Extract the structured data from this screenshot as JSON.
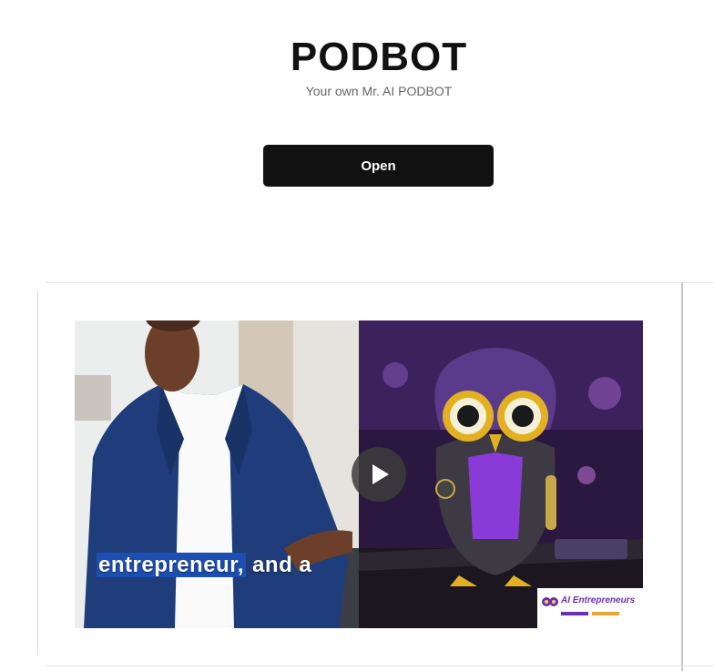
{
  "header": {
    "title": "PODBOT",
    "subtitle": "Your own Mr. AI PODBOT"
  },
  "actions": {
    "open_label": "Open"
  },
  "video": {
    "caption_highlight": "entrepreneur,",
    "caption_rest": " and a",
    "watermark_text": "AI Entrepreneurs",
    "play_icon": "play-icon"
  },
  "colors": {
    "button_bg": "#111111",
    "caption_highlight": "#1d4fb3",
    "watermark_accent": "#6a2fb5"
  }
}
